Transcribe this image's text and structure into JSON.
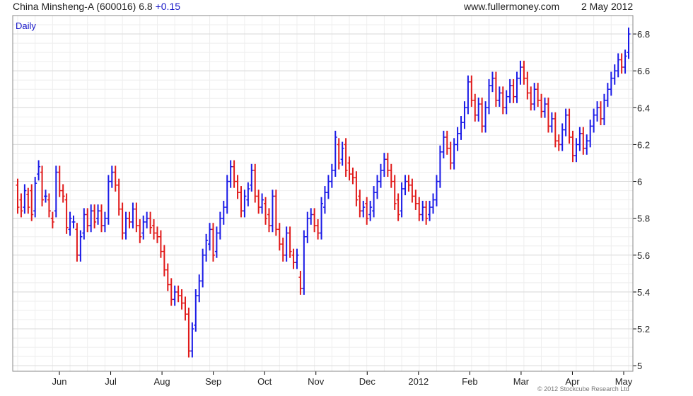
{
  "header": {
    "name": "China Minsheng-A (600016)",
    "last": "6.8",
    "change": "+0.15",
    "site": "www.fullermoney.com",
    "date": "2 May 2012"
  },
  "copyright": "© 2012 Stockcube Research Ltd",
  "colors": {
    "up": "#1a1ae6",
    "down": "#e01a1a",
    "grid": "#d9d9d9",
    "grid_minor": "#eeeeee",
    "axis": "#000000",
    "label_accent": "#1515c8"
  },
  "chart_data": {
    "type": "ohlc",
    "period_label": "Daily",
    "y_ticks": [
      "5",
      "5.2",
      "5.4",
      "5.6",
      "5.8",
      "6",
      "6.2",
      "6.4",
      "6.6",
      "6.8"
    ],
    "ylim": [
      4.97,
      6.9
    ],
    "x_ticks": [
      "Jun",
      "Jul",
      "Aug",
      "Sep",
      "Oct",
      "Nov",
      "Dec",
      "2012",
      "Feb",
      "Mar",
      "Apr",
      "May"
    ],
    "grid": true,
    "series": [
      {
        "values": [
          [
            5.98,
            5.86
          ],
          [
            5.9,
            5.84
          ],
          [
            5.86,
            5.95
          ],
          [
            5.93,
            5.86
          ],
          [
            5.95,
            5.82
          ],
          [
            5.84,
            5.99
          ],
          [
            6.04,
            6.08
          ],
          [
            6.05,
            5.9
          ],
          [
            5.92,
            5.92
          ],
          [
            5.9,
            5.84
          ],
          [
            5.8,
            5.78
          ],
          [
            5.84,
            6.05
          ],
          [
            6.05,
            5.95
          ],
          [
            5.95,
            5.92
          ],
          [
            5.9,
            5.75
          ],
          [
            5.74,
            5.8
          ],
          [
            5.78,
            5.78
          ],
          [
            5.74,
            5.6
          ],
          [
            5.6,
            5.7
          ],
          [
            5.72,
            5.82
          ],
          [
            5.82,
            5.76
          ],
          [
            5.76,
            5.84
          ],
          [
            5.84,
            5.78
          ],
          [
            5.8,
            5.84
          ],
          [
            5.84,
            5.76
          ],
          [
            5.76,
            5.8
          ],
          [
            5.8,
            6.0
          ],
          [
            6.0,
            6.05
          ],
          [
            6.05,
            5.98
          ],
          [
            5.98,
            5.85
          ],
          [
            5.85,
            5.72
          ],
          [
            5.72,
            5.8
          ],
          [
            5.8,
            5.78
          ],
          [
            5.78,
            5.85
          ],
          [
            5.85,
            5.76
          ],
          [
            5.76,
            5.7
          ],
          [
            5.72,
            5.78
          ],
          [
            5.78,
            5.8
          ],
          [
            5.8,
            5.75
          ],
          [
            5.76,
            5.72
          ],
          [
            5.72,
            5.7
          ],
          [
            5.7,
            5.62
          ],
          [
            5.62,
            5.52
          ],
          [
            5.52,
            5.44
          ],
          [
            5.44,
            5.36
          ],
          [
            5.36,
            5.4
          ],
          [
            5.4,
            5.38
          ],
          [
            5.38,
            5.34
          ],
          [
            5.34,
            5.28
          ],
          [
            5.28,
            5.08
          ],
          [
            5.08,
            5.2
          ],
          [
            5.22,
            5.38
          ],
          [
            5.38,
            5.46
          ],
          [
            5.46,
            5.6
          ],
          [
            5.6,
            5.68
          ],
          [
            5.66,
            5.74
          ],
          [
            5.74,
            5.6
          ],
          [
            5.62,
            5.72
          ],
          [
            5.72,
            5.8
          ],
          [
            5.8,
            5.86
          ],
          [
            5.86,
            6.0
          ],
          [
            6.0,
            6.08
          ],
          [
            6.08,
            6.0
          ],
          [
            6.0,
            5.94
          ],
          [
            5.94,
            5.84
          ],
          [
            5.84,
            5.92
          ],
          [
            5.9,
            5.96
          ],
          [
            5.98,
            6.06
          ],
          [
            6.06,
            5.92
          ],
          [
            5.92,
            5.86
          ],
          [
            5.86,
            5.9
          ],
          [
            5.88,
            5.8
          ],
          [
            5.82,
            5.76
          ],
          [
            5.76,
            5.92
          ],
          [
            5.92,
            5.74
          ],
          [
            5.74,
            5.66
          ],
          [
            5.66,
            5.6
          ],
          [
            5.6,
            5.72
          ],
          [
            5.72,
            5.62
          ],
          [
            5.6,
            5.56
          ],
          [
            5.56,
            5.6
          ],
          [
            5.48,
            5.42
          ],
          [
            5.42,
            5.7
          ],
          [
            5.7,
            5.8
          ],
          [
            5.8,
            5.82
          ],
          [
            5.82,
            5.76
          ],
          [
            5.76,
            5.72
          ],
          [
            5.72,
            5.88
          ],
          [
            5.86,
            5.94
          ],
          [
            5.94,
            6.0
          ],
          [
            6.0,
            6.06
          ],
          [
            6.06,
            6.24
          ],
          [
            6.2,
            6.1
          ],
          [
            6.12,
            6.18
          ],
          [
            6.2,
            6.06
          ],
          [
            6.1,
            6.04
          ],
          [
            6.04,
            6.02
          ],
          [
            6.02,
            5.9
          ],
          [
            5.92,
            5.84
          ],
          [
            5.84,
            5.86
          ],
          [
            5.88,
            5.8
          ],
          [
            5.82,
            5.86
          ],
          [
            5.84,
            5.94
          ],
          [
            5.94,
            6.0
          ],
          [
            6.0,
            6.06
          ],
          [
            6.06,
            6.12
          ],
          [
            6.12,
            6.06
          ],
          [
            6.06,
            6.0
          ],
          [
            6.0,
            5.88
          ],
          [
            5.9,
            5.82
          ],
          [
            5.84,
            5.96
          ],
          [
            5.96,
            6.0
          ],
          [
            6.0,
            5.98
          ],
          [
            5.98,
            5.92
          ],
          [
            5.92,
            5.88
          ],
          [
            5.88,
            5.82
          ],
          [
            5.82,
            5.86
          ],
          [
            5.86,
            5.8
          ],
          [
            5.82,
            5.86
          ],
          [
            5.86,
            5.9
          ],
          [
            5.9,
            6.0
          ],
          [
            6.0,
            6.16
          ],
          [
            6.16,
            6.24
          ],
          [
            6.24,
            6.18
          ],
          [
            6.18,
            6.1
          ],
          [
            6.1,
            6.2
          ],
          [
            6.2,
            6.26
          ],
          [
            6.26,
            6.32
          ],
          [
            6.32,
            6.4
          ],
          [
            6.4,
            6.54
          ],
          [
            6.54,
            6.44
          ],
          [
            6.44,
            6.36
          ],
          [
            6.36,
            6.42
          ],
          [
            6.42,
            6.3
          ],
          [
            6.3,
            6.4
          ],
          [
            6.4,
            6.52
          ],
          [
            6.52,
            6.56
          ],
          [
            6.56,
            6.44
          ],
          [
            6.44,
            6.48
          ],
          [
            6.48,
            6.4
          ],
          [
            6.4,
            6.46
          ],
          [
            6.46,
            6.52
          ],
          [
            6.52,
            6.46
          ],
          [
            6.46,
            6.56
          ],
          [
            6.56,
            6.62
          ],
          [
            6.62,
            6.56
          ],
          [
            6.56,
            6.48
          ],
          [
            6.48,
            6.42
          ],
          [
            6.42,
            6.5
          ],
          [
            6.5,
            6.44
          ],
          [
            6.44,
            6.38
          ],
          [
            6.38,
            6.42
          ],
          [
            6.42,
            6.3
          ],
          [
            6.3,
            6.34
          ],
          [
            6.34,
            6.22
          ],
          [
            6.22,
            6.2
          ],
          [
            6.2,
            6.28
          ],
          [
            6.28,
            6.36
          ],
          [
            6.36,
            6.24
          ],
          [
            6.24,
            6.14
          ],
          [
            6.14,
            6.2
          ],
          [
            6.2,
            6.26
          ],
          [
            6.26,
            6.18
          ],
          [
            6.18,
            6.22
          ],
          [
            6.22,
            6.3
          ],
          [
            6.3,
            6.36
          ],
          [
            6.36,
            6.4
          ],
          [
            6.4,
            6.34
          ],
          [
            6.34,
            6.44
          ],
          [
            6.44,
            6.5
          ],
          [
            6.5,
            6.56
          ],
          [
            6.56,
            6.6
          ],
          [
            6.6,
            6.66
          ],
          [
            6.66,
            6.62
          ],
          [
            6.62,
            6.68
          ],
          [
            6.7,
            6.8
          ]
        ]
      }
    ]
  }
}
